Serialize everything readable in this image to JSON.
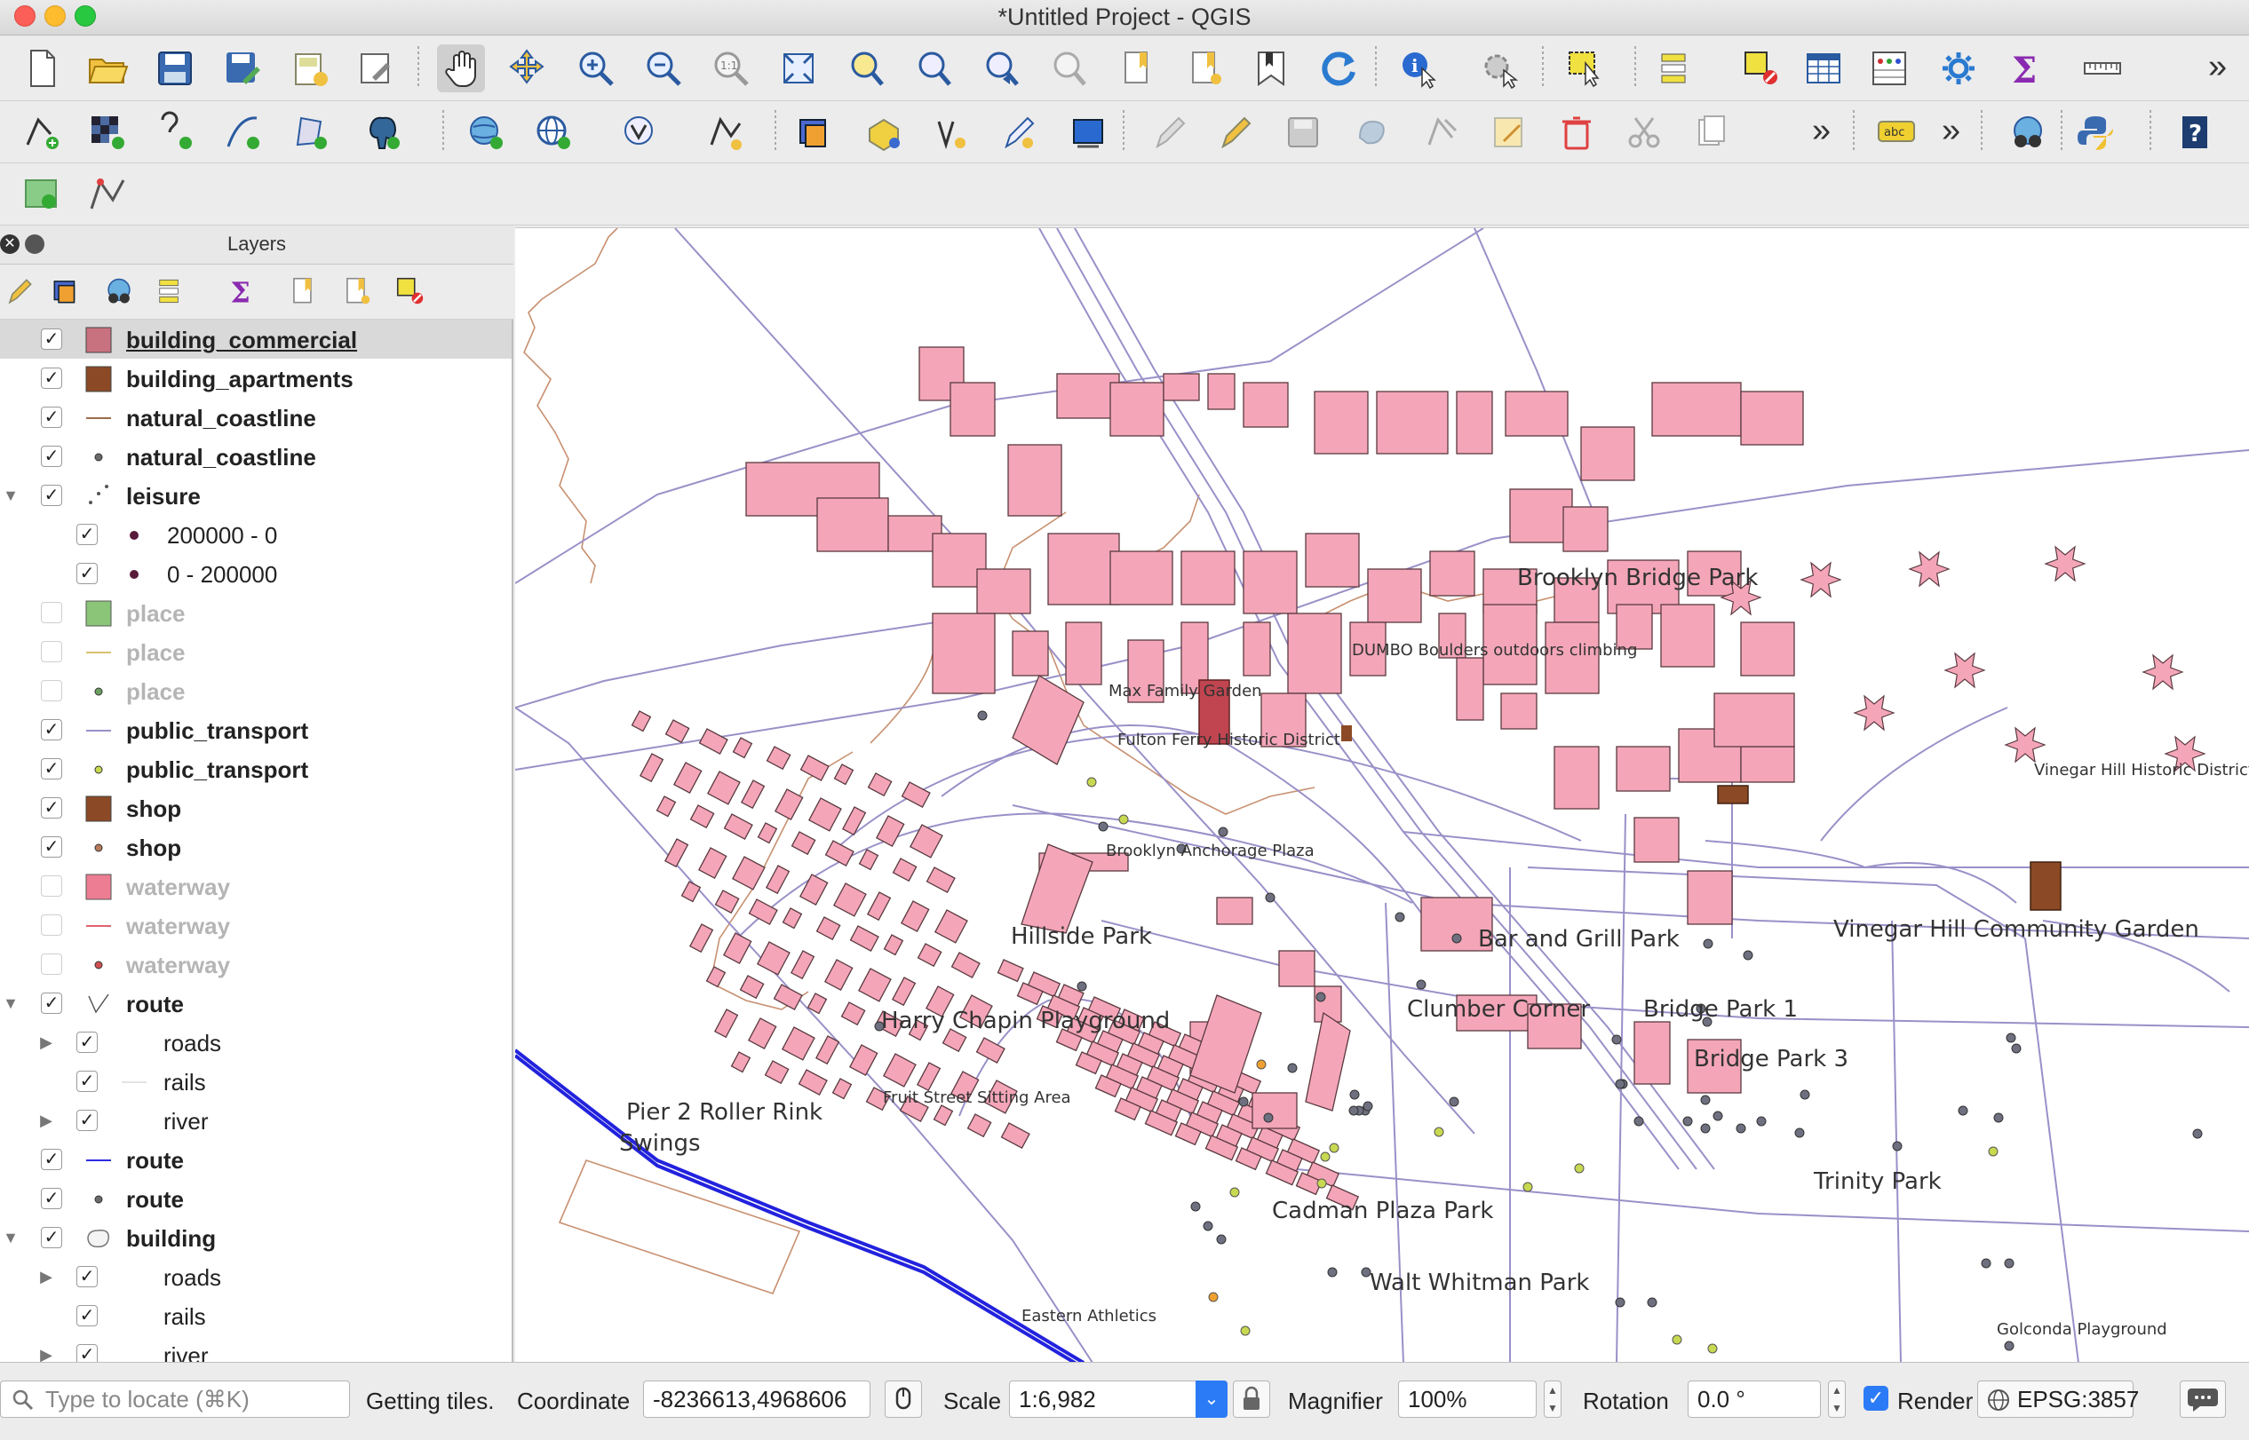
{
  "window": {
    "title": "*Untitled Project - QGIS"
  },
  "toolbar": {
    "overflow_label": "»",
    "label_tool_text": "abc"
  },
  "layers_panel": {
    "title": "Layers",
    "close_glyph": "✕",
    "items": [
      {
        "name": "building_commercial",
        "checked": true,
        "bold": true,
        "selected": true,
        "underline": true,
        "indent": 0,
        "symbol": "fill",
        "color": "#c9727f"
      },
      {
        "name": "building_apartments",
        "checked": true,
        "bold": true,
        "indent": 0,
        "symbol": "fill",
        "color": "#8b4a25"
      },
      {
        "name": "natural_coastline",
        "checked": true,
        "bold": true,
        "indent": 0,
        "symbol": "line",
        "color": "#9c6b49"
      },
      {
        "name": "natural_coastline",
        "checked": true,
        "bold": true,
        "indent": 0,
        "symbol": "point",
        "color": "#6a6a6a"
      },
      {
        "name": "leisure",
        "checked": true,
        "bold": true,
        "indent": 0,
        "symbol": "group-points",
        "expanded": true
      },
      {
        "name": "200000 - 0",
        "checked": true,
        "bold": false,
        "indent": 1,
        "symbol": "dot",
        "color": "#5a1a3a"
      },
      {
        "name": "0 - 200000",
        "checked": true,
        "bold": false,
        "indent": 1,
        "symbol": "dot",
        "color": "#5a1a3a"
      },
      {
        "name": "place",
        "checked": false,
        "bold": true,
        "dim": true,
        "indent": 0,
        "symbol": "fill",
        "color": "#7fbf6a"
      },
      {
        "name": "place",
        "checked": false,
        "bold": true,
        "dim": true,
        "indent": 0,
        "symbol": "line",
        "color": "#d8c070"
      },
      {
        "name": "place",
        "checked": false,
        "bold": true,
        "dim": true,
        "indent": 0,
        "symbol": "point",
        "color": "#6ca060"
      },
      {
        "name": "public_transport",
        "checked": true,
        "bold": true,
        "indent": 0,
        "symbol": "line",
        "color": "#9a90c8"
      },
      {
        "name": "public_transport",
        "checked": true,
        "bold": true,
        "indent": 0,
        "symbol": "point",
        "color": "#c8d850"
      },
      {
        "name": "shop",
        "checked": true,
        "bold": true,
        "indent": 0,
        "symbol": "fill",
        "color": "#8b4a25"
      },
      {
        "name": "shop",
        "checked": true,
        "bold": true,
        "indent": 0,
        "symbol": "point",
        "color": "#b77a5a"
      },
      {
        "name": "waterway",
        "checked": false,
        "bold": true,
        "dim": true,
        "indent": 0,
        "symbol": "fill",
        "color": "#ea6f88"
      },
      {
        "name": "waterway",
        "checked": false,
        "bold": true,
        "dim": true,
        "indent": 0,
        "symbol": "line",
        "color": "#e06070"
      },
      {
        "name": "waterway",
        "checked": false,
        "bold": true,
        "dim": true,
        "indent": 0,
        "symbol": "point",
        "color": "#d05050"
      },
      {
        "name": "route",
        "checked": true,
        "bold": true,
        "indent": 0,
        "symbol": "group-lines",
        "expanded": true
      },
      {
        "name": "roads",
        "checked": true,
        "bold": false,
        "indent": 1,
        "symbol": "none",
        "collapsed": true
      },
      {
        "name": "rails",
        "checked": true,
        "bold": false,
        "indent": 1,
        "symbol": "faint-line"
      },
      {
        "name": "river",
        "checked": true,
        "bold": false,
        "indent": 1,
        "symbol": "none",
        "collapsed": true
      },
      {
        "name": "route",
        "checked": true,
        "bold": true,
        "indent": 0,
        "symbol": "line",
        "color": "#2d2de0"
      },
      {
        "name": "route",
        "checked": true,
        "bold": true,
        "indent": 0,
        "symbol": "point",
        "color": "#6a6a6a"
      },
      {
        "name": "building",
        "checked": true,
        "bold": true,
        "indent": 0,
        "symbol": "group-polygons",
        "expanded": true
      },
      {
        "name": "roads",
        "checked": true,
        "bold": false,
        "indent": 1,
        "symbol": "none",
        "collapsed": true
      },
      {
        "name": "rails",
        "checked": true,
        "bold": false,
        "indent": 1,
        "symbol": "none"
      },
      {
        "name": "river",
        "checked": true,
        "bold": false,
        "indent": 1,
        "symbol": "none",
        "collapsed": true
      }
    ]
  },
  "map": {
    "labels": [
      {
        "text": "Brooklyn Bridge Park",
        "size": "large"
      },
      {
        "text": "DUMBO Boulders outdoors climbing",
        "size": "small"
      },
      {
        "text": "Max Family Garden",
        "size": "small"
      },
      {
        "text": "Fulton Ferry Historic District",
        "size": "small"
      },
      {
        "text": "Brooklyn Anchorage Plaza",
        "size": "small"
      },
      {
        "text": "Hillside Park",
        "size": "large"
      },
      {
        "text": "Bar and Grill Park",
        "size": "large"
      },
      {
        "text": "Vinegar Hill Community Garden",
        "size": "large"
      },
      {
        "text": "Vinegar Hill Historic District",
        "size": "small"
      },
      {
        "text": "Harry Chapin Playground",
        "size": "large"
      },
      {
        "text": "Clumber Corner",
        "size": "large"
      },
      {
        "text": "Bridge Park 1",
        "size": "large"
      },
      {
        "text": "Bridge Park 3",
        "size": "large"
      },
      {
        "text": "Pier 2 Roller Rink",
        "size": "large"
      },
      {
        "text": "Swings",
        "size": "large"
      },
      {
        "text": "Fruit Street Sitting Area",
        "size": "small"
      },
      {
        "text": "Trinity Park",
        "size": "large"
      },
      {
        "text": "Cadman Plaza Park",
        "size": "large"
      },
      {
        "text": "Walt Whitman Park",
        "size": "large"
      },
      {
        "text": "Eastern Athletics",
        "size": "small"
      },
      {
        "text": "Golconda Playground",
        "size": "small"
      }
    ],
    "colors": {
      "building_fill": "#f4a6b8",
      "building_stroke": "#5a3a40",
      "commercial_fill": "#c04550",
      "apartments_fill": "#8b4a25",
      "road_line": "#9a90c8",
      "coastline": "#c89070",
      "route_line": "#2222dd",
      "node_fill": "#6e7080"
    }
  },
  "status": {
    "locator_placeholder": "Type to locate (⌘K)",
    "message": "Getting tiles.",
    "coordinate_label": "Coordinate",
    "coordinate_value": "-8236613,4968606",
    "scale_label": "Scale",
    "scale_value": "1:6,982",
    "magnifier_label": "Magnifier",
    "magnifier_value": "100%",
    "rotation_label": "Rotation",
    "rotation_value": "0.0 °",
    "render_label": "Render",
    "render_checked": true,
    "crs": "EPSG:3857"
  }
}
